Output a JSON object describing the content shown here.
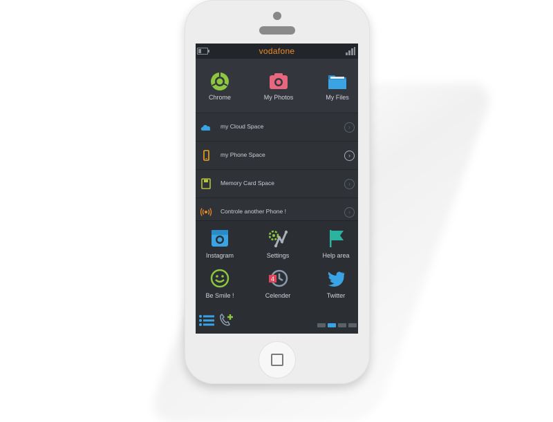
{
  "status_bar": {
    "carrier": "vodafone"
  },
  "top_apps": [
    {
      "label": "Chrome",
      "icon": "chrome-icon",
      "color": "#8dc63f"
    },
    {
      "label": "My Photos",
      "icon": "camera-icon",
      "color": "#e8677f"
    },
    {
      "label": "My Files",
      "icon": "folder-icon",
      "color": "#3aa3e3"
    }
  ],
  "list": [
    {
      "label": "my Cloud Space",
      "icon": "cloud-icon",
      "color": "#3aa3e3",
      "active": false
    },
    {
      "label": "my Phone Space",
      "icon": "phone-icon",
      "color": "#f0a21e",
      "active": true
    },
    {
      "label": "Memory Card Space",
      "icon": "floppy-icon",
      "color": "#b6c33c",
      "active": false
    },
    {
      "label": "Controle another Phone !",
      "icon": "broadcast-icon",
      "color": "#f08a28",
      "active": false
    }
  ],
  "grid_apps": [
    {
      "label": "Instagram",
      "icon": "instagram-icon",
      "color": "#3aa3e3"
    },
    {
      "label": "Settings",
      "icon": "settings-icon",
      "color": "#8dc63f"
    },
    {
      "label": "Help area",
      "icon": "flag-icon",
      "color": "#2bb3a0"
    },
    {
      "label": "Be Smile !",
      "icon": "smile-icon",
      "color": "#8dc63f"
    },
    {
      "label": "Celender",
      "icon": "clock-icon",
      "color": "#8a9aad",
      "badge": "4"
    },
    {
      "label": "Twitter",
      "icon": "twitter-icon",
      "color": "#3aa3e3"
    }
  ],
  "dock": {
    "left_icons": [
      "list-icon",
      "add-call-icon"
    ],
    "pages": 4,
    "active_page": 2
  },
  "colors": {
    "screen_bg": "#2f3338",
    "accent": "#3aa3e3",
    "carrier": "#f08a28"
  }
}
